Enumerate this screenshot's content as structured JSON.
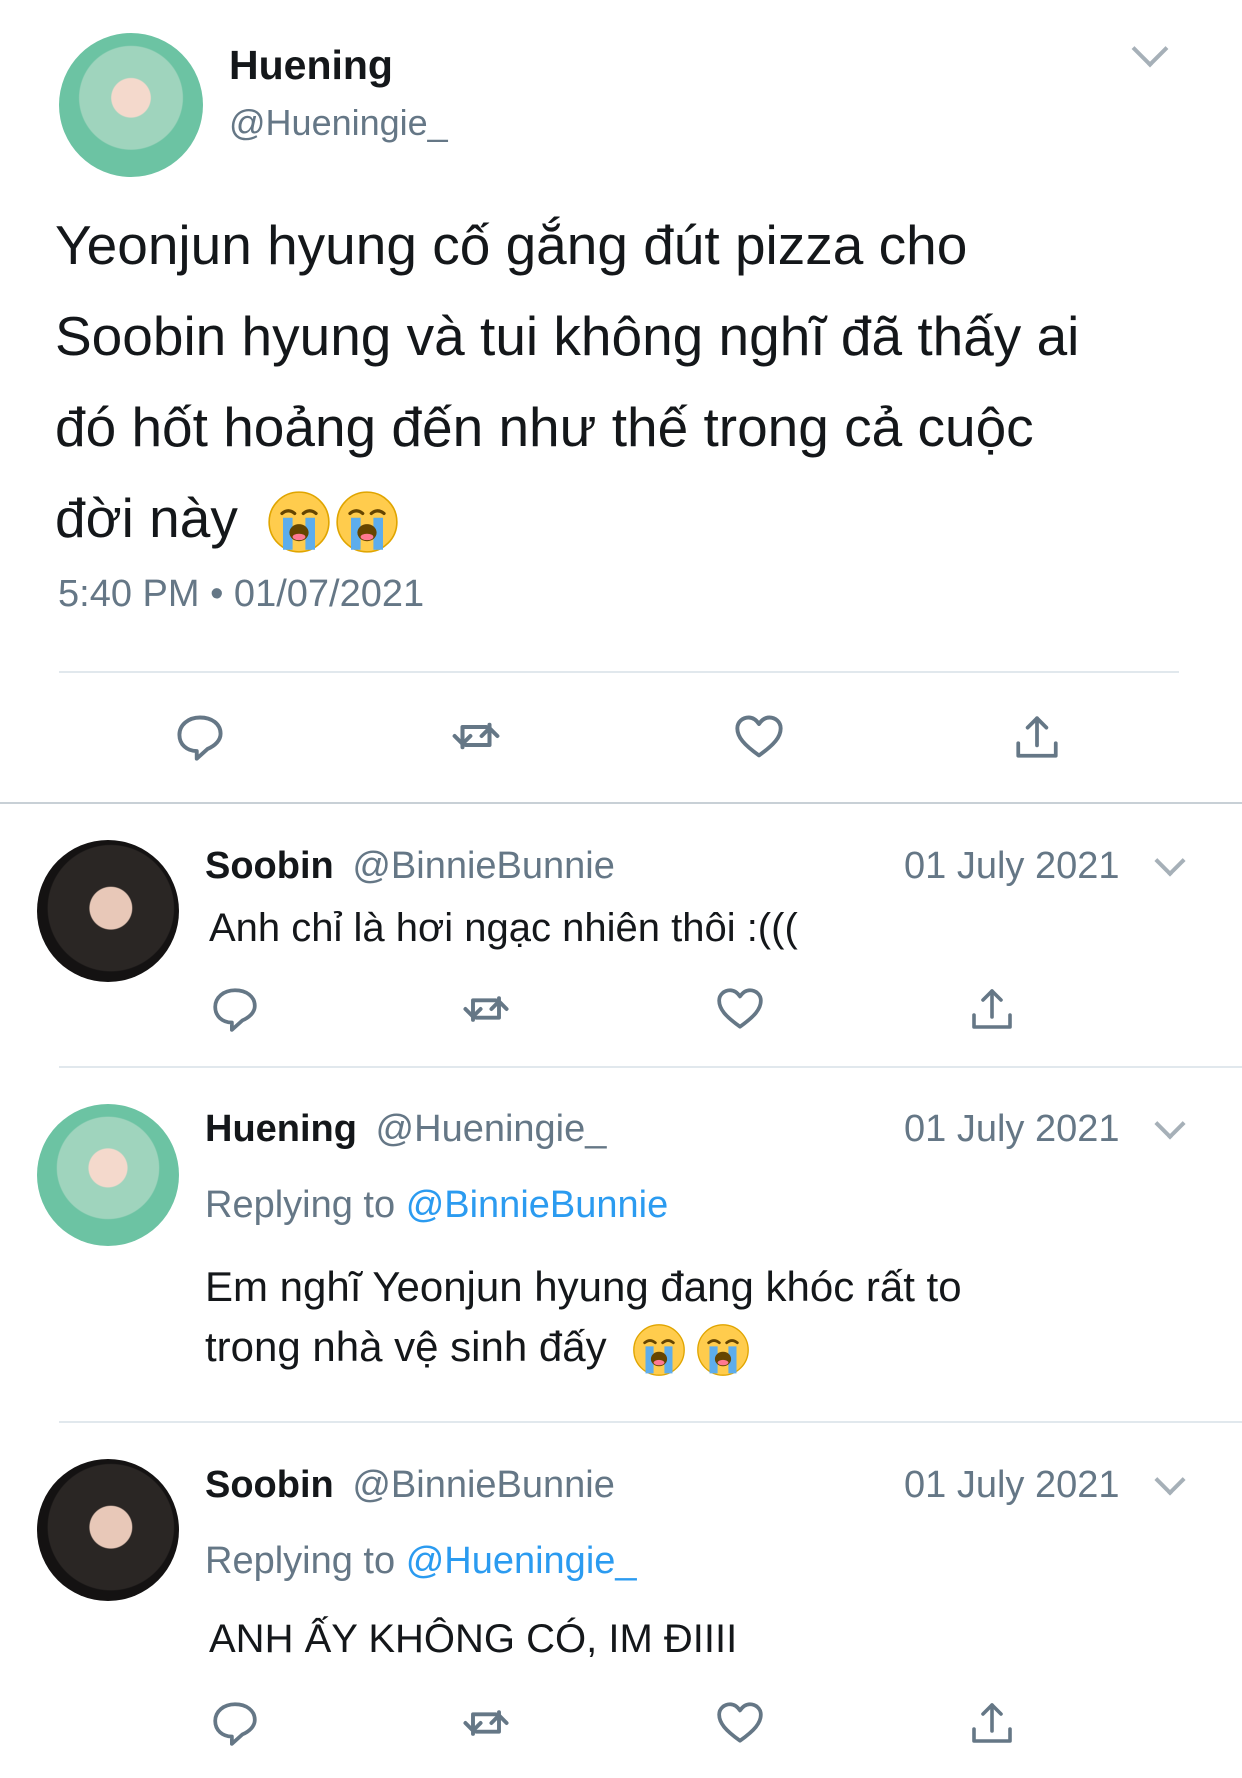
{
  "main_tweet": {
    "display_name": "Huening",
    "handle": "@Hueningie_",
    "text_lines": [
      "Yeonjun hyung cố gắng đút pizza cho",
      "Soobin hyung và tui không nghĩ đã thấy ai",
      "đó hốt hoảng đến như thế trong cả cuộc",
      "đời này"
    ],
    "timestamp": "5:40 PM • 01/07/2021"
  },
  "replies": [
    {
      "display_name": "Soobin",
      "handle": "@BinnieBunnie",
      "date": "01 July 2021",
      "text_lines": [
        "Anh chỉ là hơi ngạc nhiên thôi :((("
      ]
    },
    {
      "display_name": "Huening",
      "handle": "@Hueningie_",
      "date": "01 July 2021",
      "replying_label": "Replying to",
      "replying_to": "@BinnieBunnie",
      "text_lines": [
        "Em nghĩ Yeonjun hyung đang khóc rất to",
        "trong nhà vệ sinh đấy"
      ]
    },
    {
      "display_name": "Soobin",
      "handle": "@BinnieBunnie",
      "date": "01 July 2021",
      "replying_label": "Replying to",
      "replying_to": "@Hueningie_",
      "text_lines": [
        "ANH ẤY KHÔNG CÓ, IM ĐIIII"
      ]
    }
  ],
  "icons": {
    "reply": "reply-icon",
    "retweet": "retweet-icon",
    "like": "heart-icon",
    "share": "share-icon",
    "emoji": "loudly-crying-face-emoji"
  },
  "colors": {
    "link": "#2b9bf0",
    "icon_gray": "#657786",
    "text": "#14171a",
    "divider": "#e1e8ed"
  }
}
